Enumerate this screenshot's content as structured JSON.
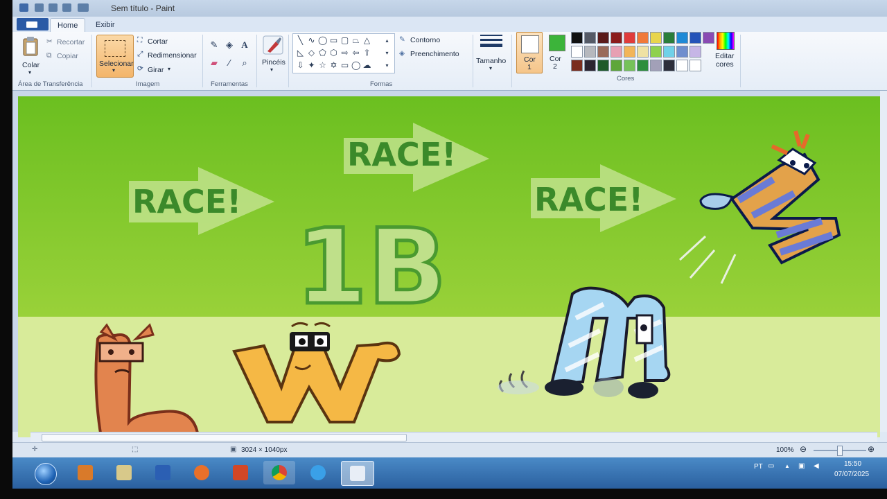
{
  "window": {
    "title": "Sem título - Paint"
  },
  "tabs": {
    "home": "Home",
    "view": "Exibir"
  },
  "clipboard": {
    "paste": "Colar",
    "cut": "Recortar",
    "copy": "Copiar",
    "group": "Área de Transferência"
  },
  "image": {
    "select": "Selecionar",
    "crop": "Cortar",
    "resize": "Redimensionar",
    "rotate": "Girar",
    "group": "Imagem"
  },
  "tools": {
    "group": "Ferramentas",
    "text_tool": "A"
  },
  "brushes": {
    "label": "Pincéis"
  },
  "shapes": {
    "outline": "Contorno",
    "fill": "Preenchimento",
    "group": "Formas"
  },
  "size": {
    "label": "Tamanho"
  },
  "colors": {
    "color1": "Cor",
    "color1_num": "1",
    "color2": "Cor",
    "color2_num": "2",
    "color1_value": "#ffffff",
    "color2_value": "#3cb43a",
    "edit": "Editar",
    "edit2": "cores",
    "group": "Cores",
    "palette_row1": [
      "#111111",
      "#555a66",
      "#5a1a1a",
      "#8b1c1c",
      "#e03b3b",
      "#f07a3a",
      "#e8d54c",
      "#2a7d3a",
      "#1f8ad6",
      "#2453b8",
      "#8a4bb3"
    ],
    "palette_row2": [
      "#ffffff",
      "#b6b8bd",
      "#9a6b5a",
      "#e7a0b3",
      "#f2b55a",
      "#efe2a4",
      "#8fd14f",
      "#6fd1e8",
      "#6f8fce",
      "#c6b6e6"
    ],
    "palette_row3": [
      "#7a2d1e",
      "#2b2430",
      "#1e5a2a",
      "#5ea63a",
      "#76c25a",
      "#2e8e3d",
      "#a2a0b8",
      "#2c2e3a",
      "#ffffff",
      "#ffffff"
    ]
  },
  "artwork": {
    "race1": "RACE!",
    "race2": "RACE!",
    "race3": "RACE!",
    "center_label": "1B"
  },
  "status": {
    "dimensions": "3024 × 1040px",
    "zoom": "100%"
  },
  "tray": {
    "lang": "PT",
    "time": "15:50",
    "date": "07/07/2025"
  }
}
